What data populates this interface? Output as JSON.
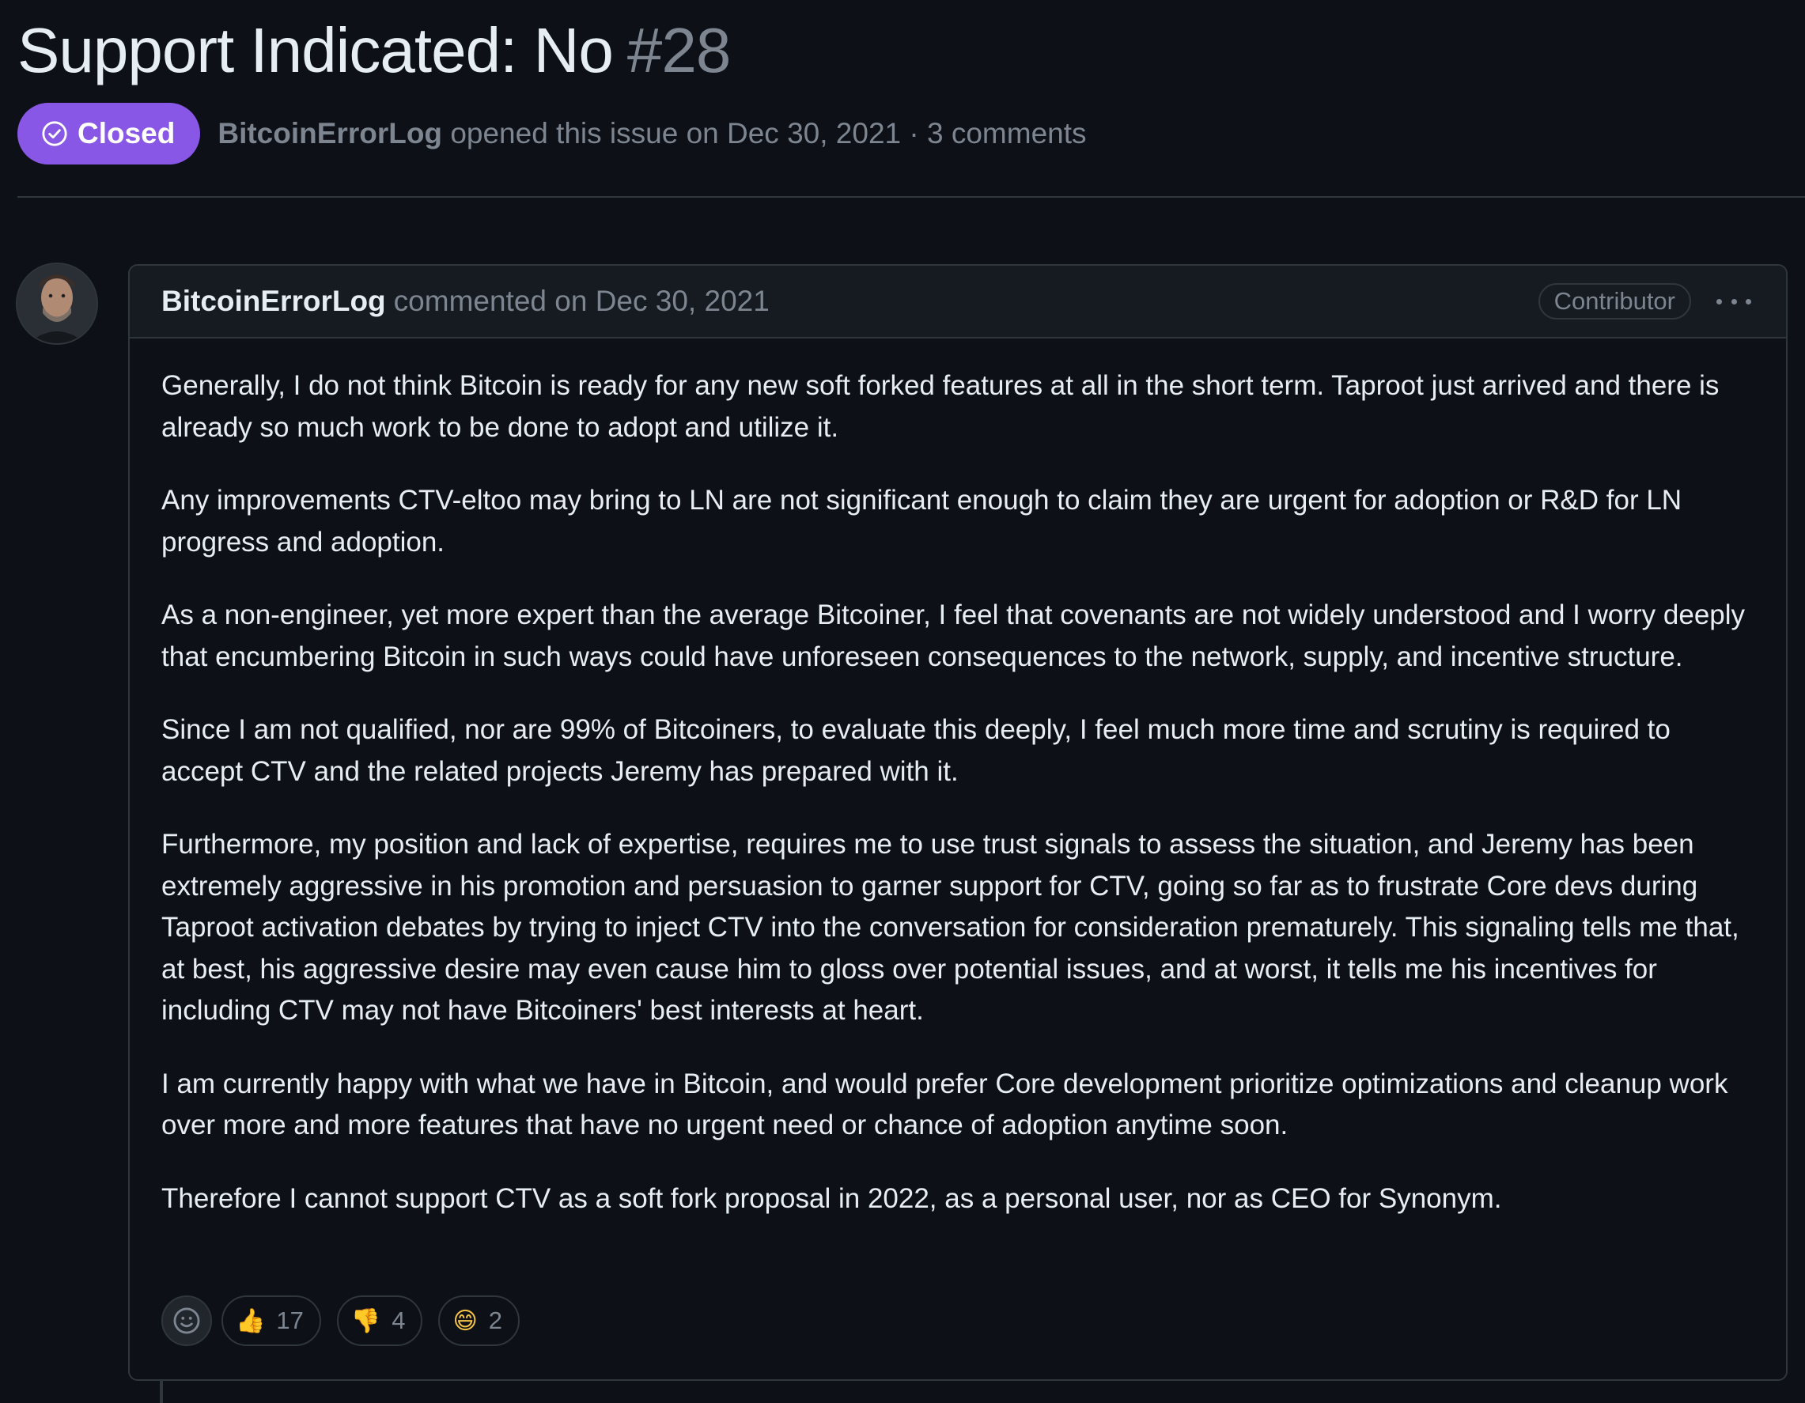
{
  "issue": {
    "title": "Support Indicated: No",
    "number": "#28",
    "status_label": "Closed",
    "status_color": "#8957e5",
    "author": "BitcoinErrorLog",
    "opened_text": "opened this issue on Dec 30, 2021 · 3 comments"
  },
  "comment": {
    "author": "BitcoinErrorLog",
    "timestamp_text": "commented on Dec 30, 2021",
    "role_badge": "Contributor",
    "menu_icon": "kebab-horizontal-icon",
    "paragraphs": [
      "Generally, I do not think Bitcoin is ready for any new soft forked features at all in the short term. Taproot just arrived and there is already so much work to be done to adopt and utilize it.",
      "Any improvements CTV-eltoo may bring to LN are not significant enough to claim they are urgent for adoption or R&D for LN progress and adoption.",
      "As a non-engineer, yet more expert than the average Bitcoiner, I feel that covenants are not widely understood and I worry deeply that encumbering Bitcoin in such ways could have unforeseen consequences to the network, supply, and incentive structure.",
      "Since I am not qualified, nor are 99% of Bitcoiners, to evaluate this deeply, I feel much more time and scrutiny is required to accept CTV and the related projects Jeremy has prepared with it.",
      "Furthermore, my position and lack of expertise, requires me to use trust signals to assess the situation, and Jeremy has been extremely aggressive in his promotion and persuasion to garner support for CTV, going so far as to frustrate Core devs during Taproot activation debates by trying to inject CTV into the conversation for consideration prematurely. This signaling tells me that, at best, his aggressive desire may even cause him to gloss over potential issues, and at worst, it tells me his incentives for including CTV may not have Bitcoiners' best interests at heart.",
      "I am currently happy with what we have in Bitcoin, and would prefer Core development prioritize optimizations and cleanup work over more and more features that have no urgent need or chance of adoption anytime soon.",
      "Therefore I cannot support CTV as a soft fork proposal in 2022, as a personal user, nor as CEO for Synonym."
    ],
    "reactions": [
      {
        "icon": "thumbs-up-icon",
        "emoji": "👍",
        "count": "17"
      },
      {
        "icon": "thumbs-down-icon",
        "emoji": "👎",
        "count": "4"
      },
      {
        "icon": "laugh-icon",
        "emoji": "😄",
        "count": "2"
      }
    ]
  }
}
